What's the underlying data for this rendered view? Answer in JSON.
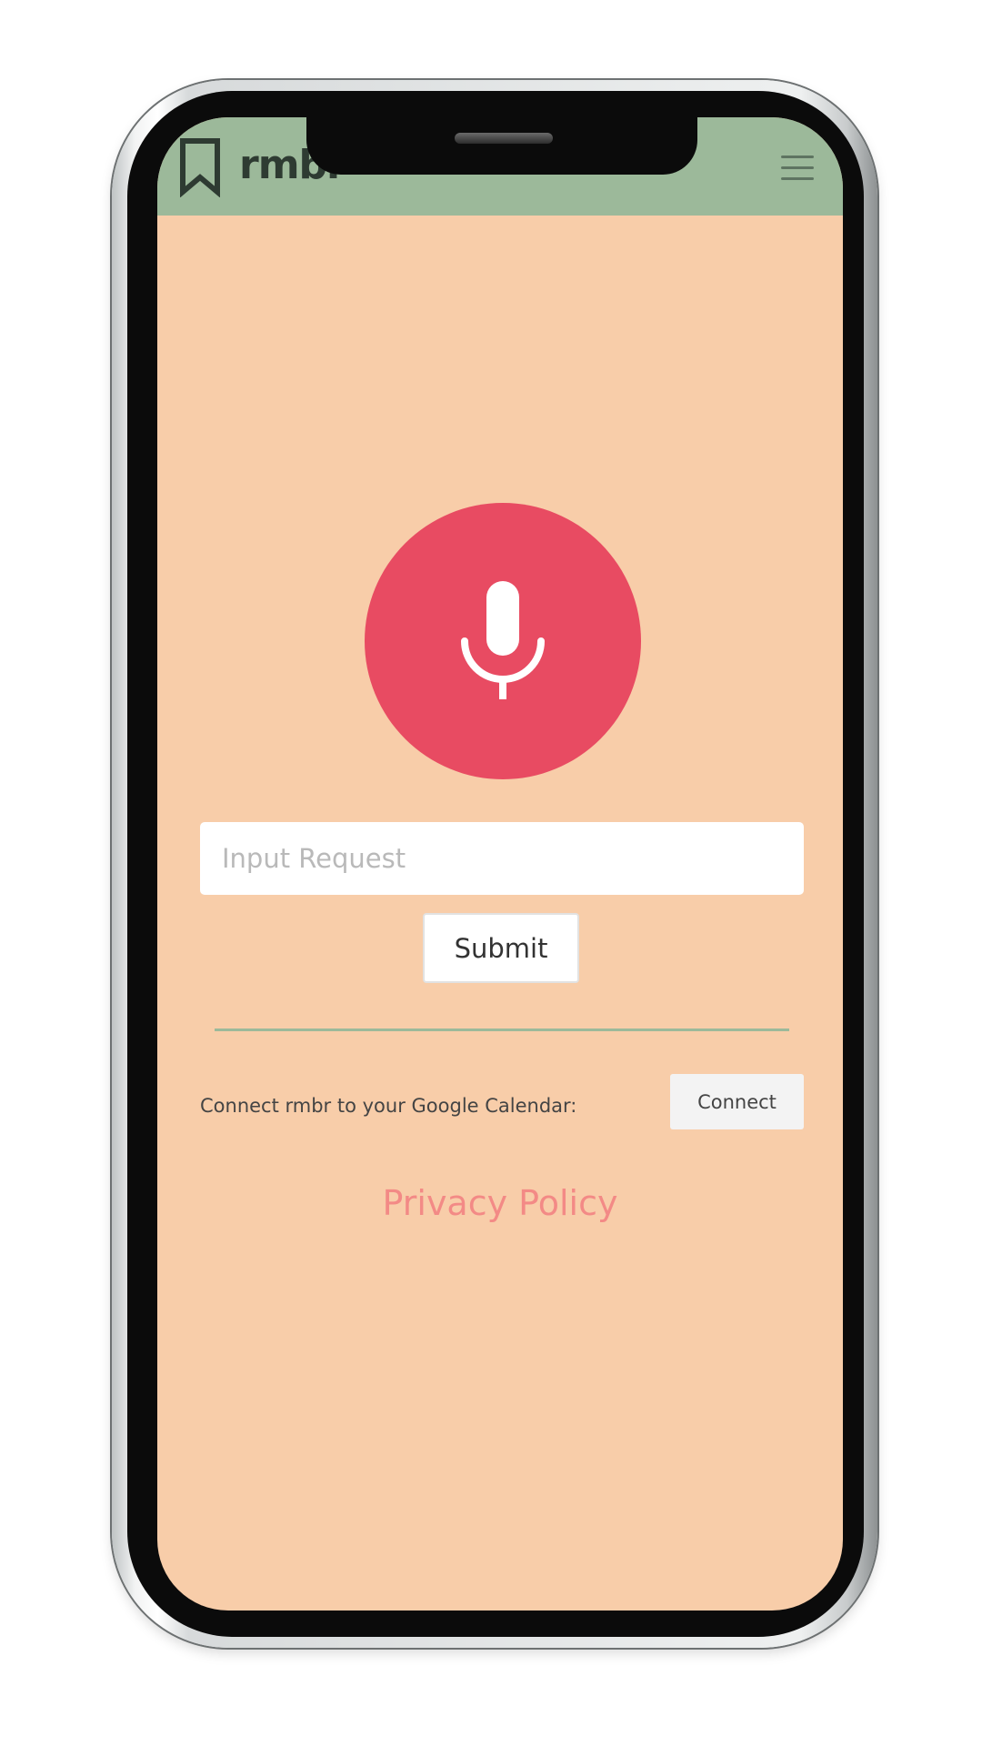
{
  "header": {
    "app_name": "rmbr",
    "background_color": "#9cb99a",
    "logo_icon": "bookmark-icon",
    "menu_icon": "hamburger-menu-icon"
  },
  "main": {
    "mic_button": {
      "icon": "microphone-icon",
      "color": "#e84b62"
    },
    "request_input": {
      "placeholder": "Input Request",
      "value": ""
    },
    "submit_label": "Submit",
    "calendar": {
      "label": "Connect rmbr to your Google Calendar:",
      "connect_label": "Connect"
    },
    "privacy_link": "Privacy Policy"
  },
  "colors": {
    "screen_background": "#f8cda9",
    "accent": "#e84b62",
    "link": "#f38a86"
  }
}
